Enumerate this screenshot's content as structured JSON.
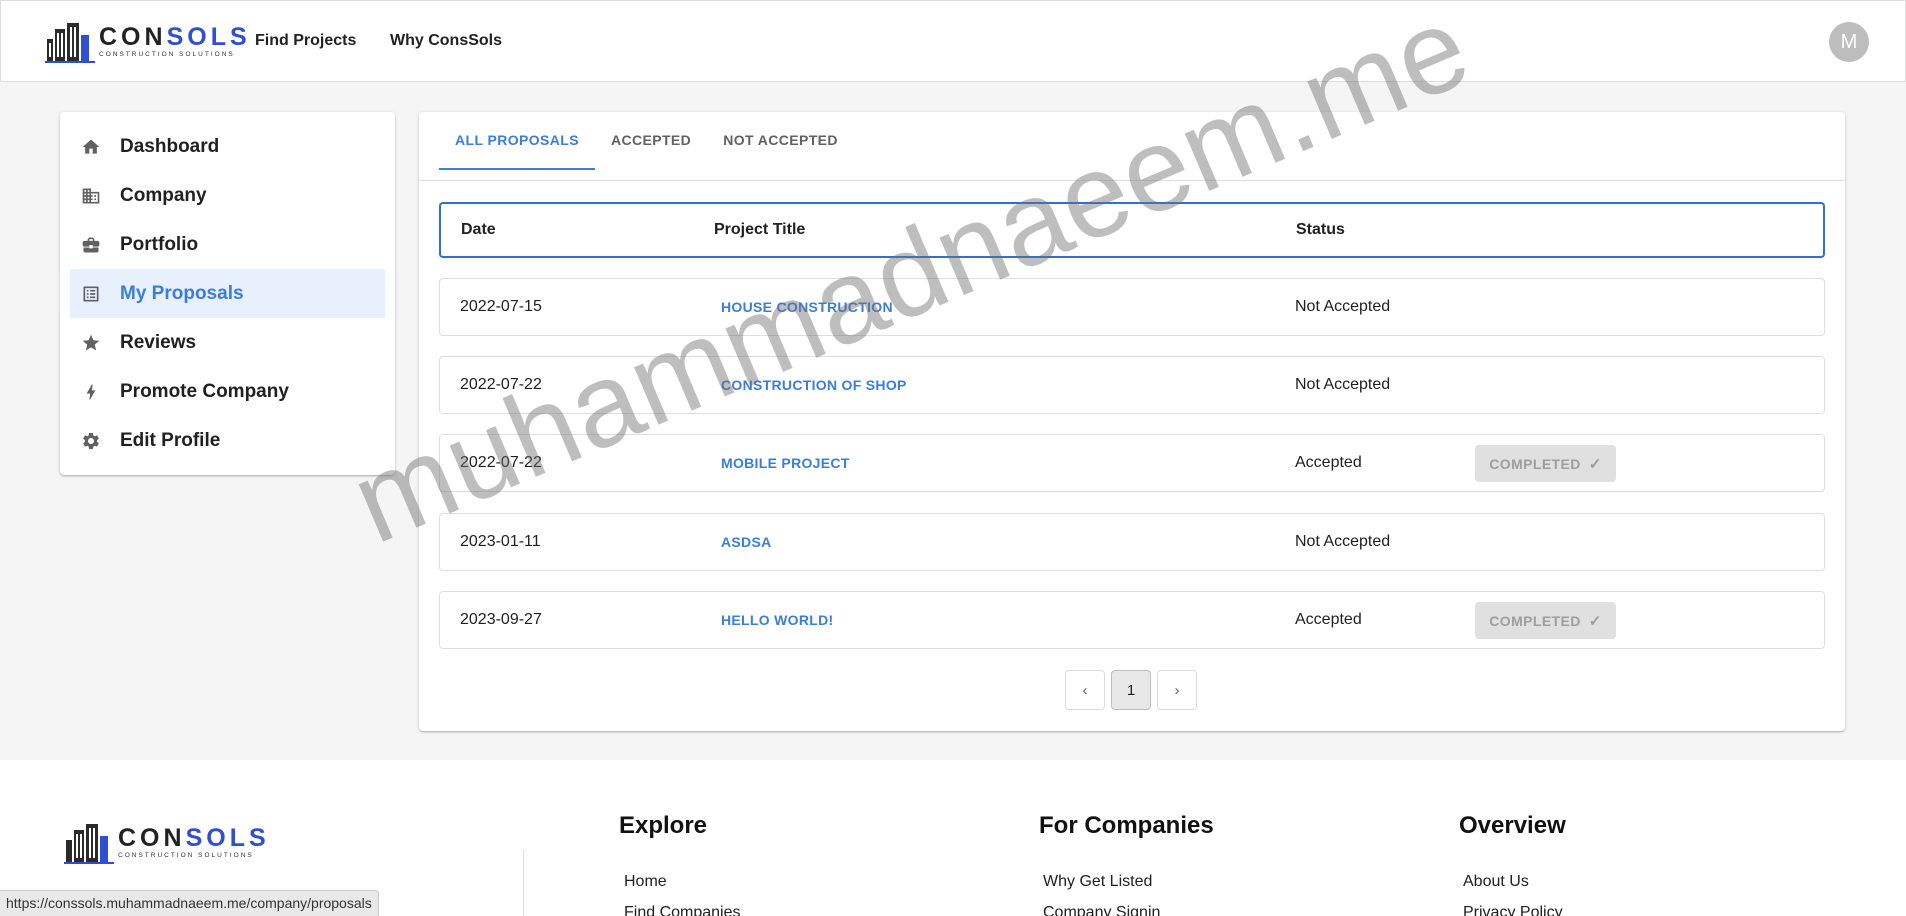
{
  "header": {
    "logo": {
      "brand_part1": "CON",
      "brand_part2": "S",
      "brand_part3": "OLS",
      "tagline": "CONSTRUCTION SOLUTIONS"
    },
    "nav": [
      {
        "label": "Find Projects"
      },
      {
        "label": "Why ConsSols"
      }
    ],
    "avatar_initial": "M"
  },
  "sidebar": {
    "items": [
      {
        "label": "Dashboard",
        "icon": "home-icon",
        "active": false
      },
      {
        "label": "Company",
        "icon": "building-icon",
        "active": false
      },
      {
        "label": "Portfolio",
        "icon": "briefcase-icon",
        "active": false
      },
      {
        "label": "My Proposals",
        "icon": "list-icon",
        "active": true
      },
      {
        "label": "Reviews",
        "icon": "star-icon",
        "active": false
      },
      {
        "label": "Promote Company",
        "icon": "bolt-icon",
        "active": false
      },
      {
        "label": "Edit Profile",
        "icon": "gear-icon",
        "active": false
      }
    ]
  },
  "main": {
    "tabs": [
      {
        "label": "ALL PROPOSALS",
        "active": true
      },
      {
        "label": "ACCEPTED",
        "active": false
      },
      {
        "label": "NOT ACCEPTED",
        "active": false
      }
    ],
    "columns": {
      "date": "Date",
      "title": "Project Title",
      "status": "Status"
    },
    "rows": [
      {
        "date": "2022-07-15",
        "title": "HOUSE CONSTRUCTION",
        "status": "Not Accepted",
        "badge": ""
      },
      {
        "date": "2022-07-22",
        "title": "CONSTRUCTION OF SHOP",
        "status": "Not Accepted",
        "badge": ""
      },
      {
        "date": "2022-07-22",
        "title": "MOBILE PROJECT",
        "status": "Accepted",
        "badge": "COMPLETED"
      },
      {
        "date": "2023-01-11",
        "title": "ASDSA",
        "status": "Not Accepted",
        "badge": ""
      },
      {
        "date": "2023-09-27",
        "title": "HELLO WORLD!",
        "status": "Accepted",
        "badge": "COMPLETED"
      }
    ],
    "pagination": {
      "current": "1"
    }
  },
  "footer": {
    "col1": {
      "title": "Explore",
      "links": [
        "Home",
        "Find Companies"
      ]
    },
    "col2": {
      "title": "For Companies",
      "links": [
        "Why Get Listed",
        "Company Signin"
      ]
    },
    "col3": {
      "title": "Overview",
      "links": [
        "About Us",
        "Privacy Policy"
      ]
    }
  },
  "status_url": "https://conssols.muhammadnaeem.me/company/proposals",
  "watermark": "muhammadnaeem.me",
  "colors": {
    "accent": "#3b7ddd",
    "brand_blue": "#2e4fd1",
    "active_bg": "#e8f0fe",
    "badge_bg": "#e0e0e0"
  }
}
